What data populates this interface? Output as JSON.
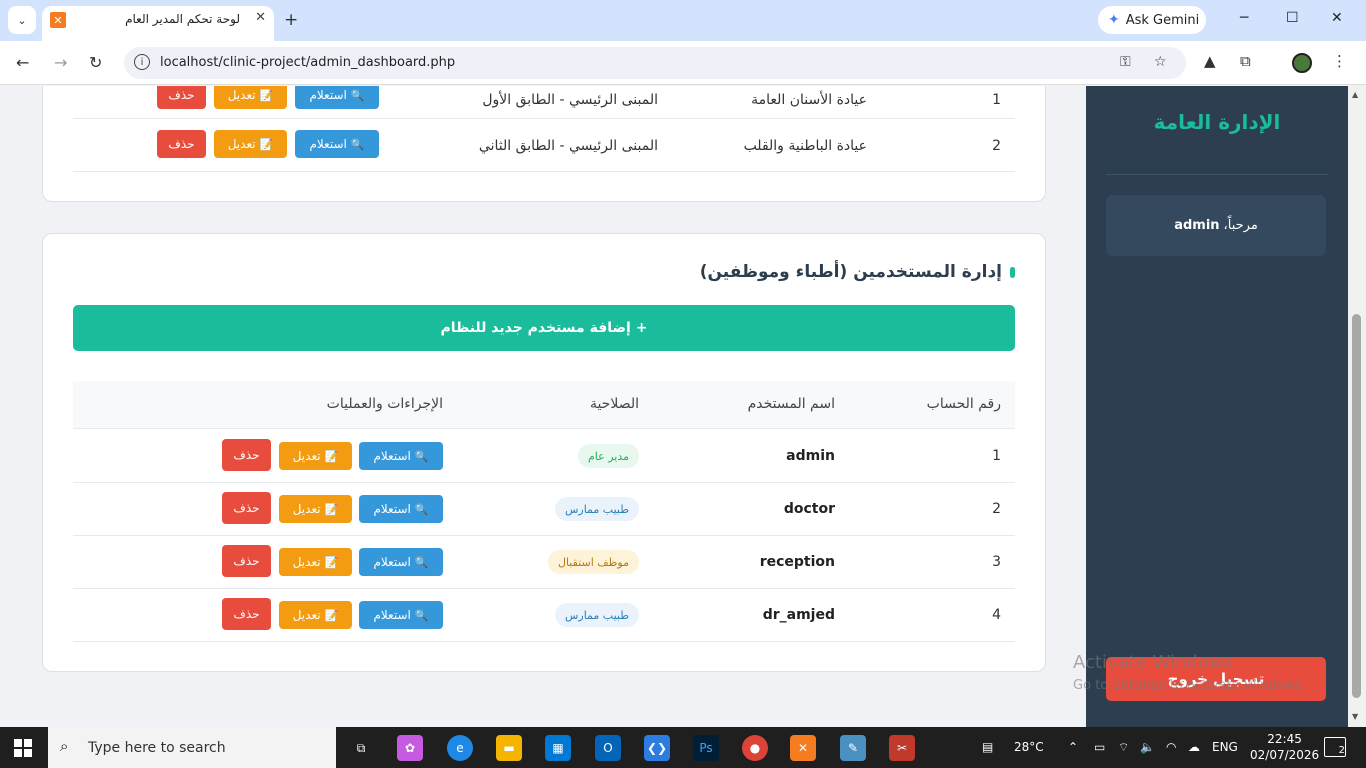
{
  "browser": {
    "tab_title": "لوحة تحكم المدير العام",
    "gemini_label": "Ask Gemini",
    "url": "localhost/clinic-project/admin_dashboard.php"
  },
  "sidebar": {
    "title": "الإدارة العامة",
    "welcome_prefix": "مرحباً،",
    "welcome_user": "admin",
    "logout_label": "تسجيل خروج"
  },
  "clinics": {
    "rows": [
      {
        "id": "1",
        "name": "عيادة الأسنان العامة",
        "location": "المبنى الرئيسي - الطابق الأول"
      },
      {
        "id": "2",
        "name": "عيادة الباطنية والقلب",
        "location": "المبنى الرئيسي - الطابق الثاني"
      }
    ]
  },
  "actions": {
    "inquiry": "استعلام",
    "edit": "تعديل",
    "delete": "حذف"
  },
  "users": {
    "section_title": "إدارة المستخدمين (أطباء وموظفين)",
    "add_button": "+ إضافة مستخدم جديد للنظام",
    "headers": [
      "رقم الحساب",
      "اسم المستخدم",
      "الصلاحية",
      "الإجراءات والعمليات"
    ],
    "rows": [
      {
        "id": "1",
        "username": "admin",
        "role": "مدير عام",
        "role_color": "#27ae60"
      },
      {
        "id": "2",
        "username": "doctor",
        "role": "طبيب ممارس",
        "role_color": "#2980b9"
      },
      {
        "id": "3",
        "username": "reception",
        "role": "موظف استقبال",
        "role_color": "#b9770e"
      },
      {
        "id": "4",
        "username": "dr_amjed",
        "role": "طبيب ممارس",
        "role_color": "#2980b9"
      }
    ]
  },
  "watermark": {
    "line1": "Activate Windows",
    "line2": "Go to Settings to activate Windows."
  },
  "taskbar": {
    "search_placeholder": "Type here to search",
    "weather": "28°C",
    "language": "ENG",
    "time": "22:45",
    "date": "02/07/2026",
    "notifications": "2"
  },
  "colors": {
    "accent": "#1abc9c",
    "sidebar_bg": "#2c3e50",
    "inquiry": "#3498db",
    "edit": "#f39c12",
    "delete": "#e74c3c"
  }
}
